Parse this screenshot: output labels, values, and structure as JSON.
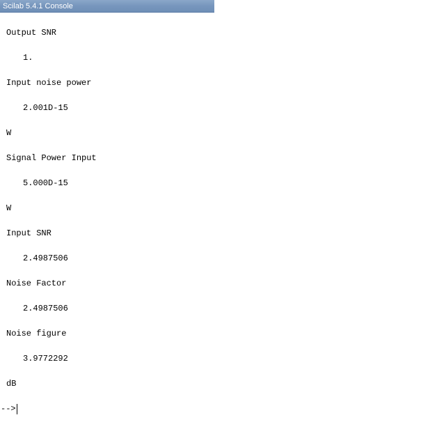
{
  "window": {
    "title": "Scilab 5.4.1 Console"
  },
  "console": {
    "lines": [
      {
        "text": "Output SNR"
      },
      {
        "text": "1."
      },
      {
        "text": "Input noise power"
      },
      {
        "text": "2.001D-15"
      },
      {
        "text": "W"
      },
      {
        "text": "Signal Power Input"
      },
      {
        "text": "5.000D-15"
      },
      {
        "text": "W"
      },
      {
        "text": "Input SNR"
      },
      {
        "text": "2.4987506"
      },
      {
        "text": "Noise Factor"
      },
      {
        "text": "2.4987506"
      },
      {
        "text": "Noise figure"
      },
      {
        "text": "3.9772292"
      },
      {
        "text": "dB"
      }
    ],
    "prompt": "-->"
  }
}
